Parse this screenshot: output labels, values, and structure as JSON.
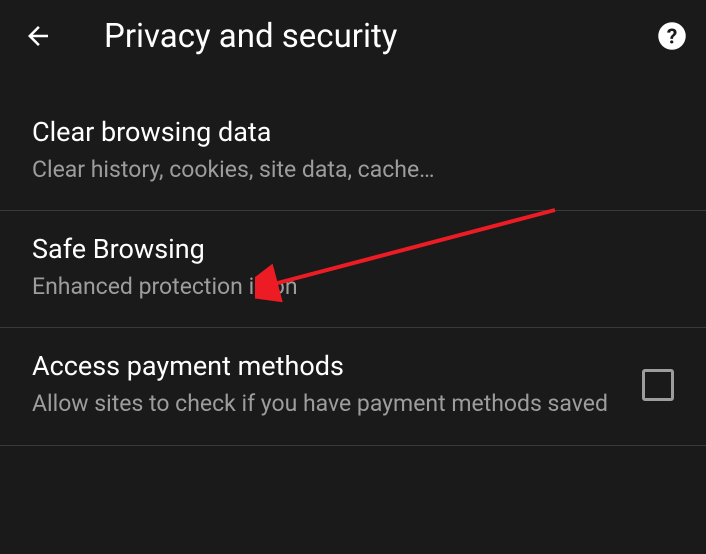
{
  "header": {
    "title": "Privacy and security"
  },
  "settings": [
    {
      "title": "Clear browsing data",
      "subtitle": "Clear history, cookies, site data, cache…",
      "hasCheckbox": false
    },
    {
      "title": "Safe Browsing",
      "subtitle": "Enhanced protection is on",
      "hasCheckbox": false
    },
    {
      "title": "Access payment methods",
      "subtitle": "Allow sites to check if you have payment methods saved",
      "hasCheckbox": true
    }
  ]
}
